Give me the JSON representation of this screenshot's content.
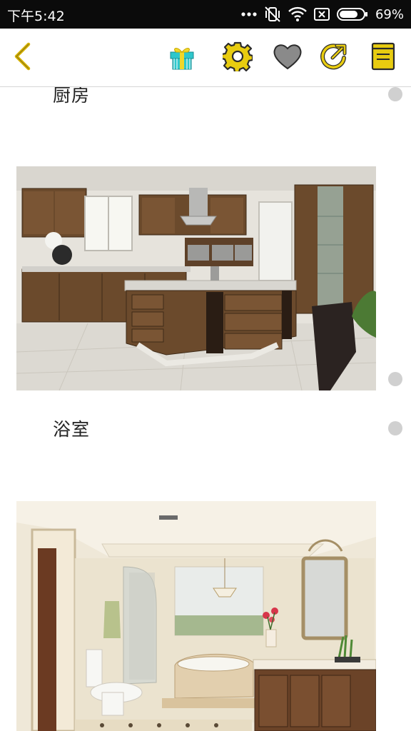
{
  "status_bar": {
    "time": "下午5:42",
    "battery": "69%",
    "icons": [
      "more-dots-icon",
      "vibrate-off-icon",
      "wifi-icon",
      "sim-x-icon",
      "battery-icon"
    ]
  },
  "toolbar": {
    "icons": [
      "back-arrow-icon",
      "gift-icon",
      "settings-gear-icon",
      "heart-icon",
      "share-icon",
      "notes-icon"
    ],
    "colors": {
      "accent": "#d8b400",
      "heart": "#8a8a8a",
      "gift": "#24c2c9"
    }
  },
  "sections": [
    {
      "title": "厨房",
      "image": "kitchen-photo"
    },
    {
      "title": "浴室",
      "image": "bathroom-photo"
    }
  ]
}
